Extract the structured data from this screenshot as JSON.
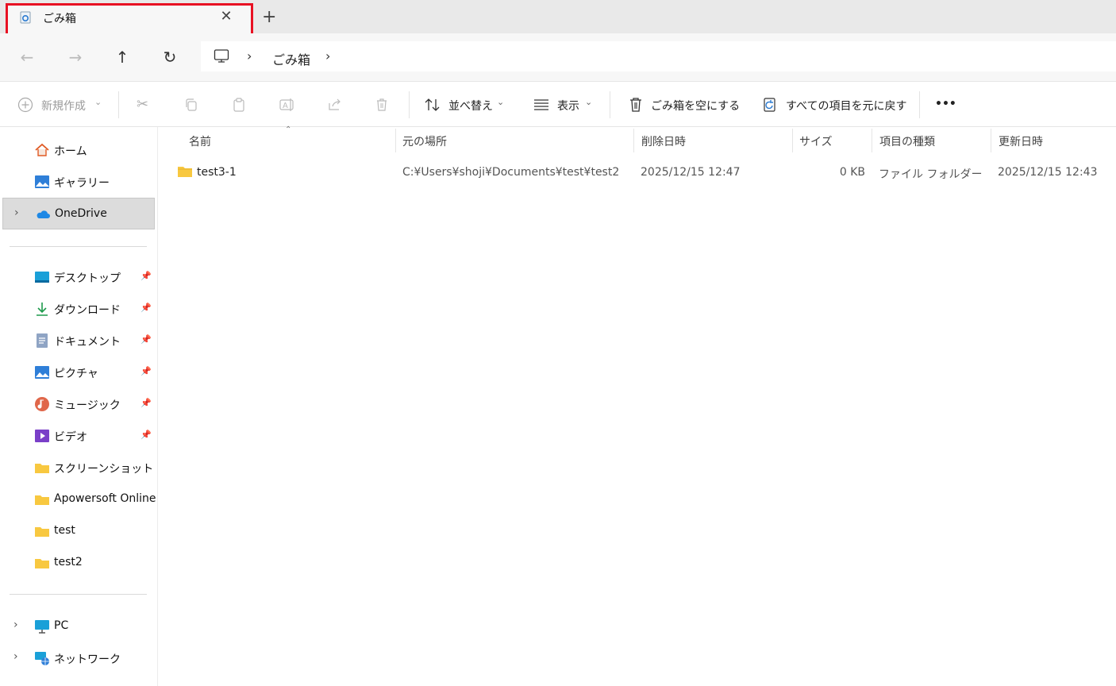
{
  "tab": {
    "title": "ごみ箱",
    "close": "✕",
    "new_tab": "+"
  },
  "nav": {
    "back": "←",
    "forward": "→",
    "up": "↑",
    "refresh": "↻"
  },
  "breadcrumb": {
    "item": "ごみ箱"
  },
  "toolbar": {
    "new_label": "新規作成",
    "sort_label": "並べ替え",
    "view_label": "表示",
    "empty_recycle_label": "ごみ箱を空にする",
    "restore_all_label": "すべての項目を元に戻す",
    "more_label": "•••"
  },
  "sidebar": {
    "quick": [
      {
        "label": "ホーム"
      },
      {
        "label": "ギャラリー"
      },
      {
        "label": "OneDrive"
      }
    ],
    "pinned": [
      {
        "label": "デスクトップ"
      },
      {
        "label": "ダウンロード"
      },
      {
        "label": "ドキュメント"
      },
      {
        "label": "ピクチャ"
      },
      {
        "label": "ミュージック"
      },
      {
        "label": "ビデオ"
      },
      {
        "label": "スクリーンショット"
      },
      {
        "label": "Apowersoft Online"
      },
      {
        "label": "test"
      },
      {
        "label": "test2"
      }
    ],
    "bottom": [
      {
        "label": "PC"
      },
      {
        "label": "ネットワーク"
      }
    ]
  },
  "table": {
    "headers": {
      "name": "名前",
      "original_location": "元の場所",
      "date_deleted": "削除日時",
      "size": "サイズ",
      "type": "項目の種類",
      "date_modified": "更新日時"
    },
    "rows": [
      {
        "name": "test3-1",
        "original_location": "C:¥Users¥shoji¥Documents¥test¥test2",
        "date_deleted": "2025/12/15 12:47",
        "size": "0 KB",
        "type": "ファイル フォルダー",
        "date_modified": "2025/12/15 12:43"
      }
    ]
  },
  "colors": {
    "highlight": "#e81123",
    "folder": "#f8c840",
    "accent": "#0078d4"
  }
}
